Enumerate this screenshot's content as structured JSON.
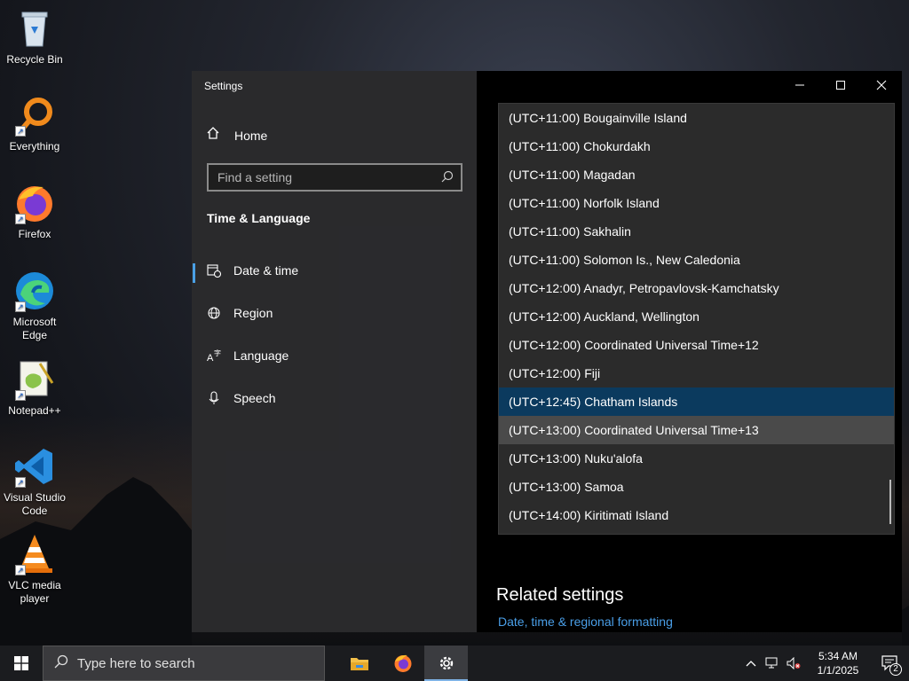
{
  "desktop": {
    "icons": [
      {
        "label": "Recycle Bin"
      },
      {
        "label": "Everything"
      },
      {
        "label": "Firefox"
      },
      {
        "label": "Microsoft Edge"
      },
      {
        "label": "Notepad++"
      },
      {
        "label": "Visual Studio Code"
      },
      {
        "label": "VLC media player"
      }
    ]
  },
  "settings": {
    "title": "Settings",
    "home_label": "Home",
    "search_placeholder": "Find a setting",
    "section_heading": "Time & Language",
    "nav": [
      {
        "label": "Date & time",
        "active": true
      },
      {
        "label": "Region"
      },
      {
        "label": "Language"
      },
      {
        "label": "Speech"
      }
    ],
    "timezones": [
      "(UTC+11:00) Bougainville Island",
      "(UTC+11:00) Chokurdakh",
      "(UTC+11:00) Magadan",
      "(UTC+11:00) Norfolk Island",
      "(UTC+11:00) Sakhalin",
      "(UTC+11:00) Solomon Is., New Caledonia",
      "(UTC+12:00) Anadyr, Petropavlovsk-Kamchatsky",
      "(UTC+12:00) Auckland, Wellington",
      "(UTC+12:00) Coordinated Universal Time+12",
      "(UTC+12:00) Fiji",
      "(UTC+12:45) Chatham Islands",
      "(UTC+13:00) Coordinated Universal Time+13",
      "(UTC+13:00) Nuku'alofa",
      "(UTC+13:00) Samoa",
      "(UTC+14:00) Kiritimati Island"
    ],
    "selected_timezone": "(UTC+12:45) Chatham Islands",
    "hovered_timezone": "(UTC+13:00) Coordinated Universal Time+13",
    "related_heading": "Related settings",
    "related_link": "Date, time & regional formatting"
  },
  "taskbar": {
    "search_placeholder": "Type here to search",
    "time": "5:34 AM",
    "date": "1/1/2025",
    "notification_count": "2"
  },
  "colors": {
    "accent": "#4aa0e6",
    "selected_row": "#0b3a5e",
    "link": "#4a9fe8"
  }
}
